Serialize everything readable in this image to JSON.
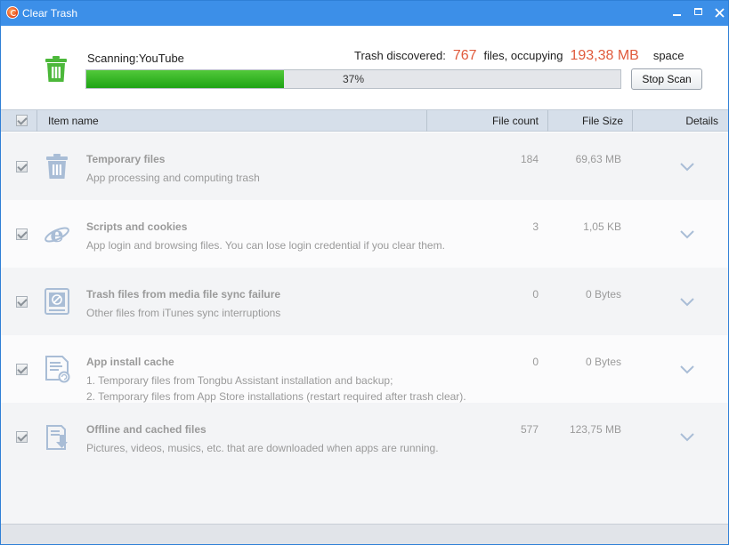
{
  "window": {
    "title": "Clear Trash",
    "accent": "#3c8fe8"
  },
  "scan": {
    "status": "Scanning:YouTube",
    "discovered_label": "Trash discovered:",
    "files_count": "767",
    "files_label": "files, occupying",
    "space_value": "193,38 MB",
    "space_label": "space",
    "progress_percent": 37,
    "progress_text": "37%",
    "stop_button": "Stop Scan"
  },
  "table": {
    "columns": {
      "name": "Item name",
      "count": "File count",
      "size": "File Size",
      "details": "Details"
    },
    "rows": [
      {
        "icon": "trash-icon",
        "name": "Temporary files",
        "desc": [
          "App processing and computing trash"
        ],
        "count": "184",
        "size": "69,63 MB"
      },
      {
        "icon": "ie-browser-icon",
        "name": "Scripts and cookies",
        "desc": [
          "App login and browsing files. You can lose login credential if you clear them."
        ],
        "count": "3",
        "size": "1,05 KB"
      },
      {
        "icon": "media-sync-icon",
        "name": "Trash files from media file sync failure",
        "desc": [
          "Other files from iTunes sync interruptions"
        ],
        "count": "0",
        "size": "0 Bytes"
      },
      {
        "icon": "install-cache-icon",
        "name": "App install cache",
        "desc": [
          "1. Temporary files from Tongbu Assistant installation and backup;",
          "2. Temporary files from App Store installations (restart required after trash clear)."
        ],
        "count": "0",
        "size": "0 Bytes"
      },
      {
        "icon": "download-icon",
        "name": "Offline and cached files",
        "desc": [
          "Pictures, videos, musics, etc. that are downloaded when apps are running."
        ],
        "count": "577",
        "size": "123,75 MB"
      }
    ]
  }
}
